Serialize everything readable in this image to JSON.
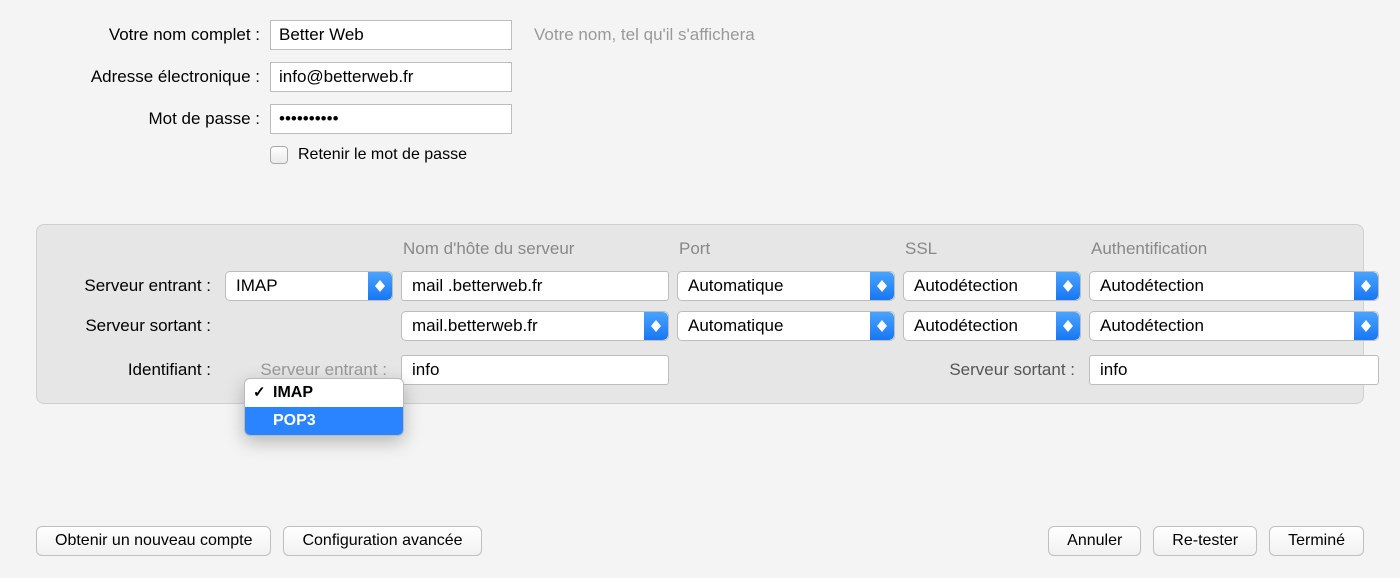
{
  "top": {
    "full_name_label": "Votre nom complet :",
    "full_name_value": "Better Web",
    "full_name_hint": "Votre nom, tel qu'il s'affichera",
    "email_label": "Adresse électronique :",
    "email_value": "info@betterweb.fr",
    "password_label": "Mot de passe :",
    "password_value": "••••••••••",
    "remember_label": "Retenir le mot de passe",
    "remember_checked": false
  },
  "server_panel": {
    "headers": {
      "hostname": "Nom d'hôte du serveur",
      "port": "Port",
      "ssl": "SSL",
      "auth": "Authentification"
    },
    "incoming": {
      "label": "Serveur entrant :",
      "protocol": "IMAP",
      "hostname": "mail .betterweb.fr",
      "port": "Automatique",
      "ssl": "Autodétection",
      "auth": "Autodétection"
    },
    "outgoing": {
      "label": "Serveur sortant :",
      "hostname": "mail.betterweb.fr",
      "port": "Automatique",
      "ssl": "Autodétection",
      "auth": "Autodétection"
    },
    "identity": {
      "label": "Identifiant :",
      "incoming_ghost": "Serveur entrant :",
      "incoming_value": "info",
      "outgoing_ghost": "Serveur sortant :",
      "outgoing_value": "info"
    }
  },
  "protocol_dropdown": {
    "options": [
      "IMAP",
      "POP3"
    ],
    "checked": "IMAP",
    "highlighted": "POP3"
  },
  "footer": {
    "new_account": "Obtenir un nouveau compte",
    "advanced": "Configuration avancée",
    "cancel": "Annuler",
    "retest": "Re-tester",
    "done": "Terminé"
  }
}
